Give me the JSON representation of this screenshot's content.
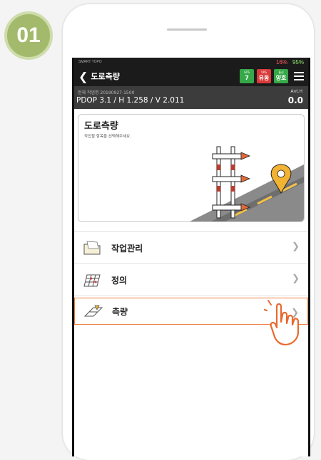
{
  "step": {
    "number": "01"
  },
  "statusbar": {
    "app": "SMART TOPO",
    "battery_red": "16%",
    "battery_green": "95%"
  },
  "titlebar": {
    "title": "도로측량",
    "chips": [
      {
        "top": "GPS",
        "value": "7"
      },
      {
        "top": "VRS",
        "value": "유동"
      },
      {
        "top": "통신",
        "value": "양호"
      }
    ]
  },
  "info": {
    "job": "현재 작업명 20190927-1500",
    "dop": "PDOP 3.1 / H 1.258 / V 2.011",
    "ant_label": "Ant.H",
    "ant_value": "0.0"
  },
  "card": {
    "title": "도로측량",
    "subtitle": "작업할 항목을 선택해주세요."
  },
  "menu": [
    {
      "label": "작업관리",
      "icon": "folder-icon"
    },
    {
      "label": "정의",
      "icon": "grid-icon"
    },
    {
      "label": "측량",
      "icon": "surveying-icon"
    }
  ],
  "colors": {
    "accent_orange": "#ee7a3a",
    "badge_green": "#a3ba6c",
    "gps_green": "#35a848",
    "vrs_red": "#d93a3a"
  }
}
